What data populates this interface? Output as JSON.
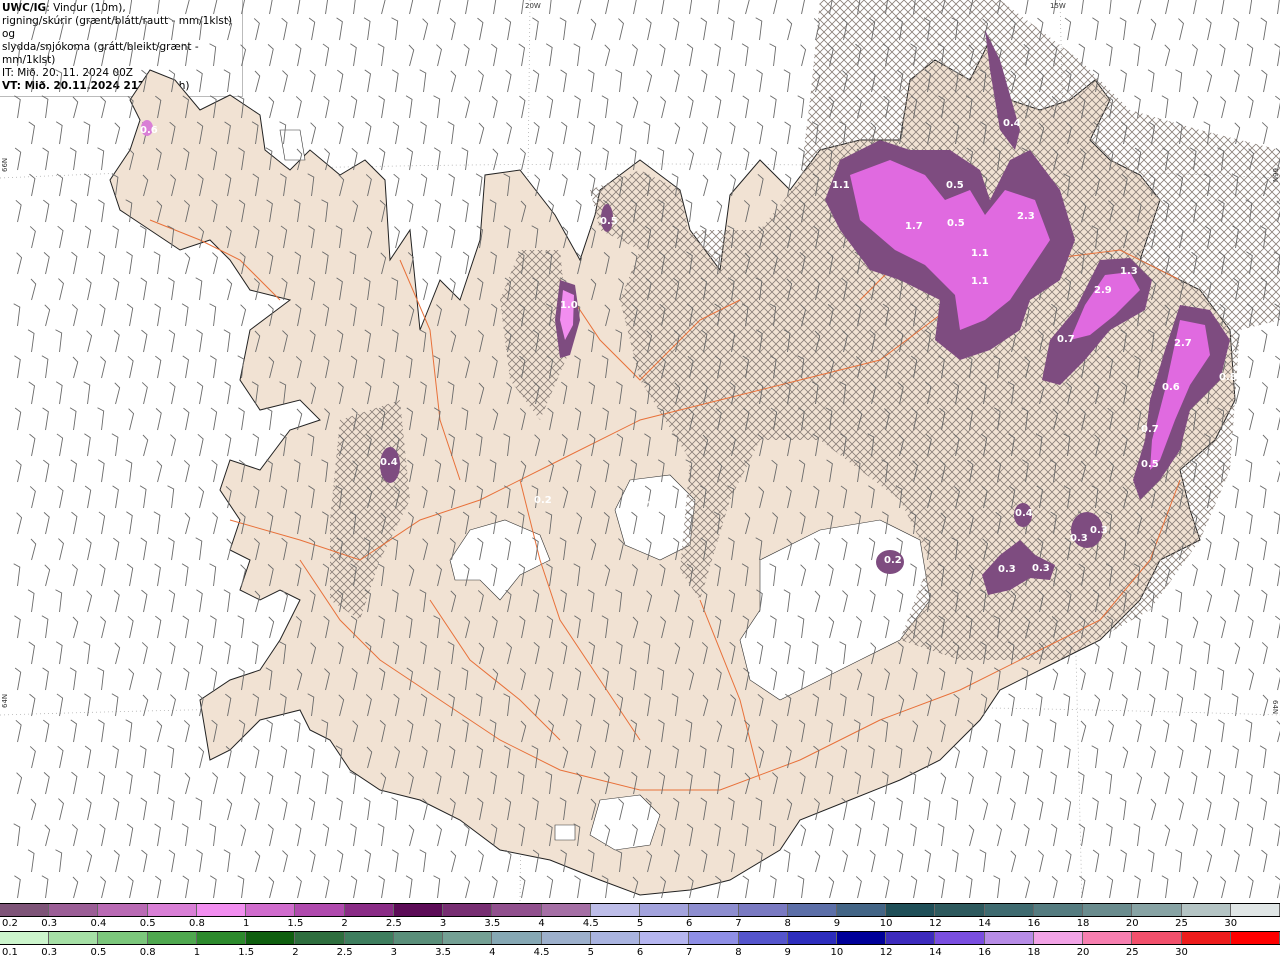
{
  "header": {
    "model": "UWC/IG",
    "line1": ": Vindur (10m),",
    "line2": "rigning/skúrir (grænt/blátt/rautt - mm/1klst) og",
    "line3": "slydda/snjókoma (grátt/bleikt/grænt - mm/1klst)",
    "init_time": "IT: Mið. 20. 11. 2024 00Z",
    "valid_label": "VT: Mið. 20.11.2024 21Z",
    "valid_offset": "(+21 h)"
  },
  "grid_labels": {
    "top_20w": "20W",
    "top_15w": "15W",
    "left_66n": "66N",
    "left_64n": "64N",
    "right_66n": "66N",
    "right_64n": "64N"
  },
  "precip_labels": [
    {
      "value": "0.6"
    },
    {
      "value": "0.5"
    },
    {
      "value": "1.0"
    },
    {
      "value": "0.4"
    },
    {
      "value": "0.2"
    },
    {
      "value": "0.2"
    },
    {
      "value": "1.1"
    },
    {
      "value": "1.7"
    },
    {
      "value": "0.5"
    },
    {
      "value": "0.5"
    },
    {
      "value": "2.3"
    },
    {
      "value": "1.1"
    },
    {
      "value": "1.1"
    },
    {
      "value": "0.4"
    },
    {
      "value": "2.9"
    },
    {
      "value": "1.3"
    },
    {
      "value": "0.7"
    },
    {
      "value": "2.7"
    },
    {
      "value": "0.6"
    },
    {
      "value": "0.8"
    },
    {
      "value": "0.7"
    },
    {
      "value": "0.5"
    },
    {
      "value": "0.4"
    },
    {
      "value": "0.3"
    },
    {
      "value": "0.3"
    },
    {
      "value": "0.3"
    },
    {
      "value": "0.3"
    },
    {
      "value": "0.2"
    }
  ],
  "snow_scale": {
    "labels": [
      "0.2",
      "0.3",
      "0.4",
      "0.5",
      "0.8",
      "1",
      "1.5",
      "2",
      "2.5",
      "3",
      "3.5",
      "4",
      "4.5",
      "5",
      "6",
      "7",
      "8",
      "9",
      "10",
      "12",
      "14",
      "16",
      "18",
      "20",
      "25",
      "30"
    ],
    "colors": [
      "#7e5478",
      "#9b5e96",
      "#b96ab4",
      "#d97fd6",
      "#f28ef0",
      "#d06ccd",
      "#b04aae",
      "#8a2c86",
      "#5c0c57",
      "#772e72",
      "#91508e",
      "#a56fa5",
      "#bdbde8",
      "#a3a3dd",
      "#8e8ed0",
      "#7a7ac2",
      "#5c6fa8",
      "#436586",
      "#1f4f58",
      "#2e5a5e",
      "#3f6b70",
      "#557c80",
      "#6a8c8e",
      "#87a3a4",
      "#b4c4c4",
      "#e0e6e6"
    ]
  },
  "rain_scale": {
    "labels": [
      "0.1",
      "0.3",
      "0.5",
      "0.8",
      "1",
      "1.5",
      "2",
      "2.5",
      "3",
      "3.5",
      "4",
      "4.5",
      "5",
      "6",
      "7",
      "8",
      "9",
      "10",
      "12",
      "14",
      "16",
      "18",
      "20",
      "25",
      "30"
    ],
    "colors": [
      "#ccf5cc",
      "#a6e0a6",
      "#7cc77c",
      "#4fa84f",
      "#2c8a2c",
      "#0f5f0f",
      "#2e6e3e",
      "#3e7e5e",
      "#5a8f7a",
      "#74a094",
      "#86a8b4",
      "#9db0cc",
      "#aab4e0",
      "#b6b6f0",
      "#8f8fe6",
      "#5555cc",
      "#2d2dbd",
      "#000099",
      "#3d2bbd",
      "#7a4ee0",
      "#b78ce6",
      "#f2a3e6",
      "#f77fb0",
      "#f2506c",
      "#ee1c1c",
      "#ff0000"
    ]
  },
  "colors": {
    "land": "#f1e2d3",
    "roads": "#e8713a",
    "coast": "#222222",
    "snow_hatch": "#8a7f78"
  }
}
